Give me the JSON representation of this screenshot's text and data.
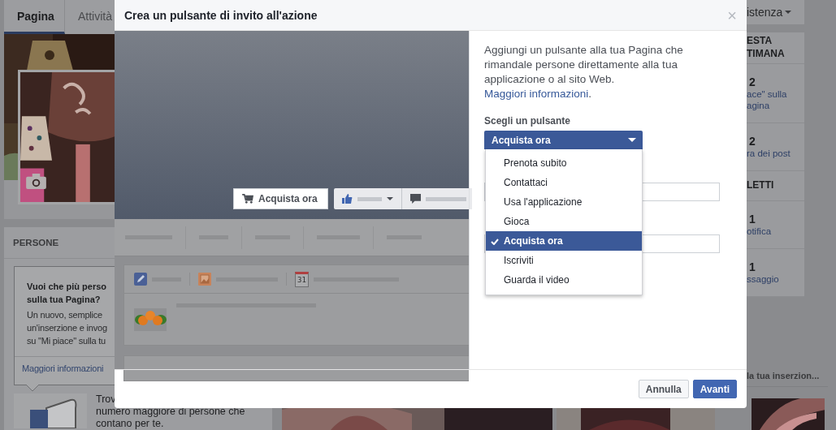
{
  "page": {
    "tabs": [
      {
        "label": "Pagina",
        "selected": true
      },
      {
        "label": "Attività",
        "selected": false
      }
    ],
    "people_panel": {
      "heading": "PERSONE",
      "tooltip": {
        "title": "Vuoi che più perso\nsulla tua Pagina?",
        "body": "Un nuovo, semplice\nun'inserzione e invog\nsu \"Mi piace\" sulla tu",
        "link": "Maggiori informazioni"
      },
      "promo_text": "Trov\nnumero maggiore di persone che\ncontano per te."
    },
    "help_menu": {
      "label": "istenza"
    },
    "stats_sections": [
      {
        "heading": "ESTA\nTIMANA",
        "stats": [
          {
            "value": "2",
            "label": "ace\" sulla\nagina"
          },
          {
            "value": "2",
            "label": "ra dei post"
          }
        ]
      },
      {
        "heading": "LETTI",
        "stats": [
          {
            "value": "1",
            "label": "otifica"
          },
          {
            "value": "1",
            "label": "ssaggio"
          }
        ]
      }
    ],
    "ad_heading": "la tua inserzion..."
  },
  "dialog": {
    "title": "Crea un pulsante di invito all'azione",
    "close": "×",
    "preview": {
      "cta_button": "Acquista ora",
      "calendar_day": "31"
    },
    "description": "Aggiungi un pulsante alla tua Pagina che rimandale persone direttamente alla tua applicazione o al sito Web.",
    "more_link": "Maggiori informazioni",
    "description_end": ".",
    "select_label": "Scegli un pulsante",
    "select_value": "Acquista ora",
    "options": [
      {
        "label": "Prenota subito",
        "selected": false
      },
      {
        "label": "Contattaci",
        "selected": false
      },
      {
        "label": "Usa l'applicazione",
        "selected": false
      },
      {
        "label": "Gioca",
        "selected": false
      },
      {
        "label": "Acquista ora",
        "selected": true
      },
      {
        "label": "Iscriviti",
        "selected": false
      },
      {
        "label": "Guarda il video",
        "selected": false
      }
    ],
    "buttons": [
      {
        "label": "Annulla",
        "kind": "secondary"
      },
      {
        "label": "Avanti",
        "kind": "primary"
      }
    ]
  }
}
